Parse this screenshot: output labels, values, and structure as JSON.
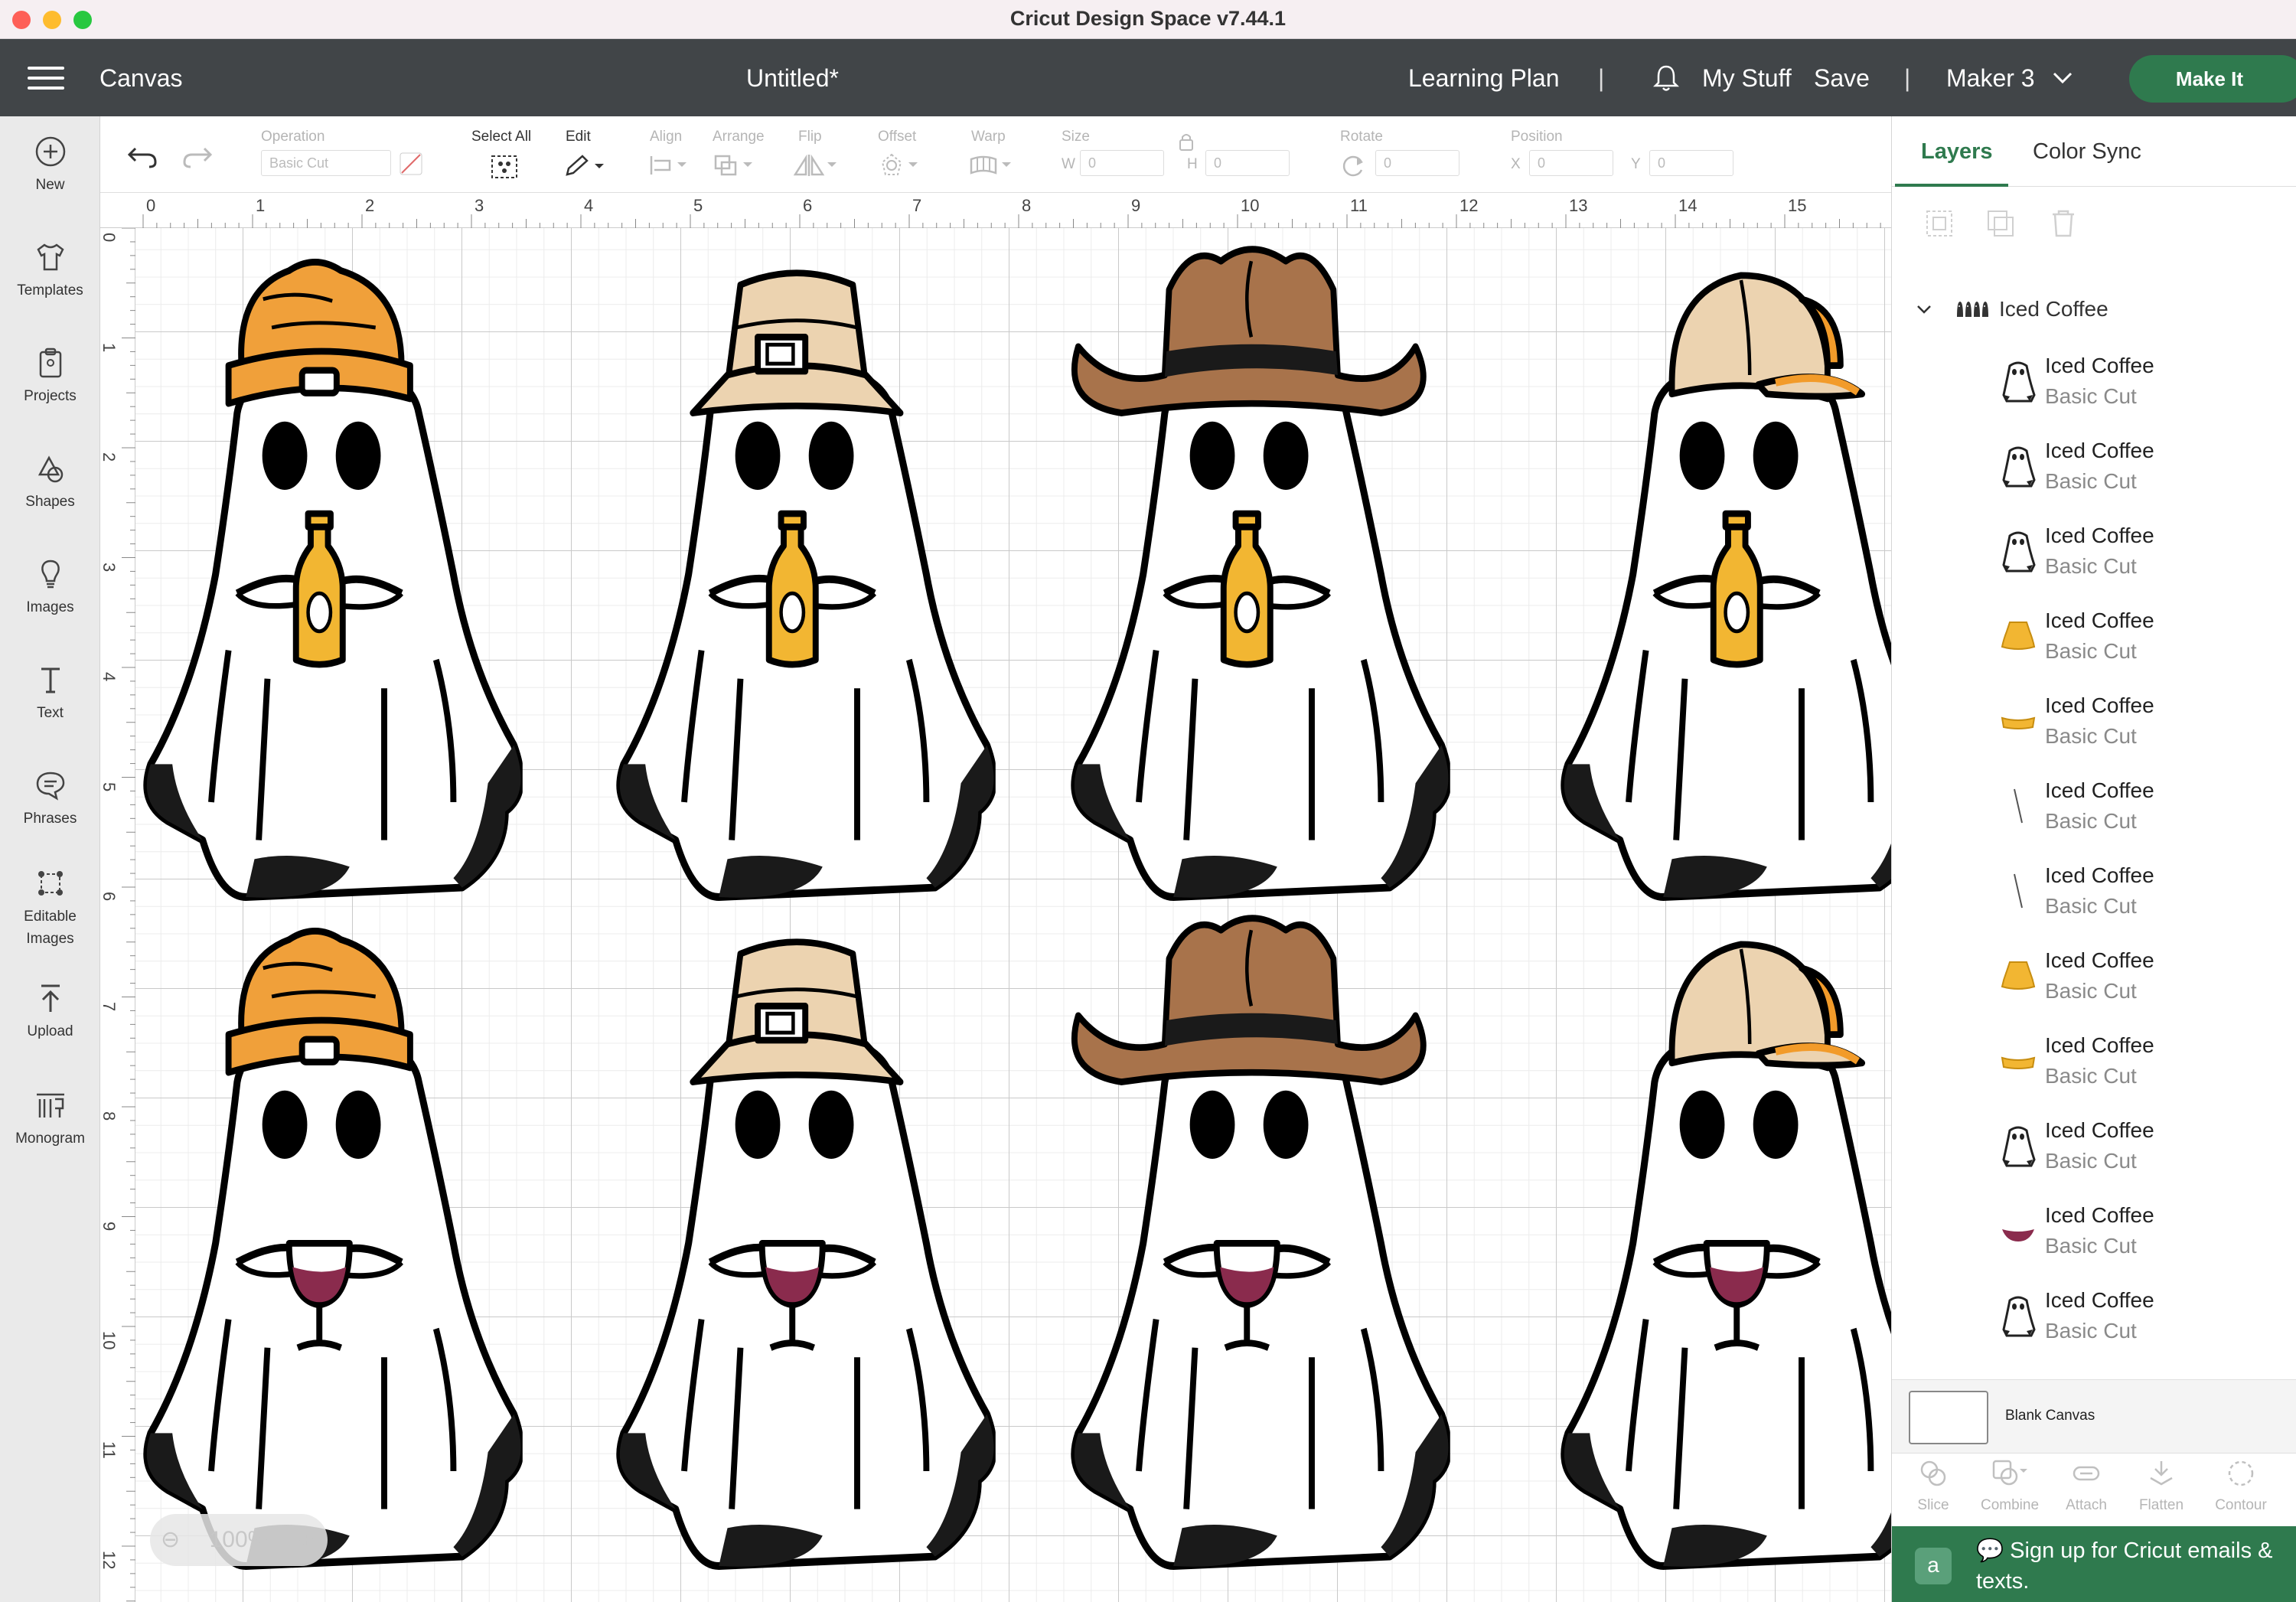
{
  "window": {
    "title": "Cricut Design Space  v7.44.1"
  },
  "header": {
    "canvas_label": "Canvas",
    "document_title": "Untitled*",
    "learning_plan": "Learning Plan",
    "separator": "|",
    "my_stuff": "My Stuff",
    "save": "Save",
    "machine": "Maker 3",
    "make_it": "Make It"
  },
  "sidebar": {
    "items": [
      {
        "label": "New",
        "icon": "plus-circle-icon"
      },
      {
        "label": "Templates",
        "icon": "tshirt-icon"
      },
      {
        "label": "Projects",
        "icon": "clipboard-icon"
      },
      {
        "label": "Shapes",
        "icon": "shapes-icon"
      },
      {
        "label": "Images",
        "icon": "lightbulb-icon"
      },
      {
        "label": "Text",
        "icon": "text-icon"
      },
      {
        "label": "Phrases",
        "icon": "speech-bubble-icon"
      },
      {
        "label": "Editable\nImages",
        "icon": "editable-image-icon"
      },
      {
        "label": "Upload",
        "icon": "upload-icon"
      },
      {
        "label": "Monogram",
        "icon": "monogram-icon"
      }
    ]
  },
  "toolbar": {
    "operation_label": "Operation",
    "operation_value": "Basic Cut",
    "select_all": "Select All",
    "edit": "Edit",
    "align": "Align",
    "arrange": "Arrange",
    "flip": "Flip",
    "offset": "Offset",
    "warp": "Warp",
    "size": "Size",
    "size_w_label": "W",
    "size_w": "0",
    "size_h_label": "H",
    "size_h": "0",
    "rotate": "Rotate",
    "rotate_value": "0",
    "position": "Position",
    "position_x_label": "X",
    "position_x": "0",
    "position_y_label": "Y",
    "position_y": "0"
  },
  "rulers": {
    "horizontal": [
      "0",
      "1",
      "2",
      "3",
      "4",
      "5",
      "6",
      "7",
      "8",
      "9",
      "10",
      "11",
      "12",
      "13",
      "14",
      "15"
    ],
    "vertical": [
      "0",
      "1",
      "2",
      "3",
      "4",
      "5",
      "6",
      "7",
      "8",
      "9",
      "10",
      "11",
      "12"
    ]
  },
  "canvas": {
    "zoom": "100%",
    "ghosts": [
      {
        "hat": "beanie",
        "drink": "beer",
        "hat_color": "#f0a03a"
      },
      {
        "hat": "bucket",
        "drink": "beer",
        "hat_color": "#ecd3b0"
      },
      {
        "hat": "cowboy",
        "drink": "beer",
        "hat_color": "#a8734b"
      },
      {
        "hat": "cap",
        "drink": "beer",
        "hat_color": "#ecd3b0"
      },
      {
        "hat": "beanie",
        "drink": "wine",
        "hat_color": "#f0a03a"
      },
      {
        "hat": "bucket",
        "drink": "wine",
        "hat_color": "#ecd3b0"
      },
      {
        "hat": "cowboy",
        "drink": "wine",
        "hat_color": "#a8734b"
      },
      {
        "hat": "cap",
        "drink": "wine",
        "hat_color": "#ecd3b0"
      }
    ]
  },
  "panel": {
    "tabs": [
      "Layers",
      "Color Sync"
    ],
    "group_name": "Iced Coffee",
    "layers": [
      {
        "name": "Iced Coffee",
        "op": "Basic Cut",
        "thumb": "ghost"
      },
      {
        "name": "Iced Coffee",
        "op": "Basic Cut",
        "thumb": "ghost"
      },
      {
        "name": "Iced Coffee",
        "op": "Basic Cut",
        "thumb": "ghost"
      },
      {
        "name": "Iced Coffee",
        "op": "Basic Cut",
        "thumb": "yellow-shape"
      },
      {
        "name": "Iced Coffee",
        "op": "Basic Cut",
        "thumb": "yellow-band"
      },
      {
        "name": "Iced Coffee",
        "op": "Basic Cut",
        "thumb": "line"
      },
      {
        "name": "Iced Coffee",
        "op": "Basic Cut",
        "thumb": "line"
      },
      {
        "name": "Iced Coffee",
        "op": "Basic Cut",
        "thumb": "yellow-shape"
      },
      {
        "name": "Iced Coffee",
        "op": "Basic Cut",
        "thumb": "yellow-band"
      },
      {
        "name": "Iced Coffee",
        "op": "Basic Cut",
        "thumb": "ghost"
      },
      {
        "name": "Iced Coffee",
        "op": "Basic Cut",
        "thumb": "wine-band"
      },
      {
        "name": "Iced Coffee",
        "op": "Basic Cut",
        "thumb": "ghost"
      }
    ],
    "blank_canvas": "Blank Canvas",
    "bottom_tools": [
      "Slice",
      "Combine",
      "Attach",
      "Flatten",
      "Contour"
    ],
    "signup_tag": "a",
    "signup_text": "💬 Sign up for Cricut emails & texts."
  },
  "colors": {
    "brand_green": "#2f7a4e",
    "header_bg": "#414548",
    "beer": "#f2b632",
    "wine": "#8a2b4d",
    "beanie": "#f0a03a",
    "cowboy": "#a8734b",
    "tan": "#ecd3b0"
  }
}
